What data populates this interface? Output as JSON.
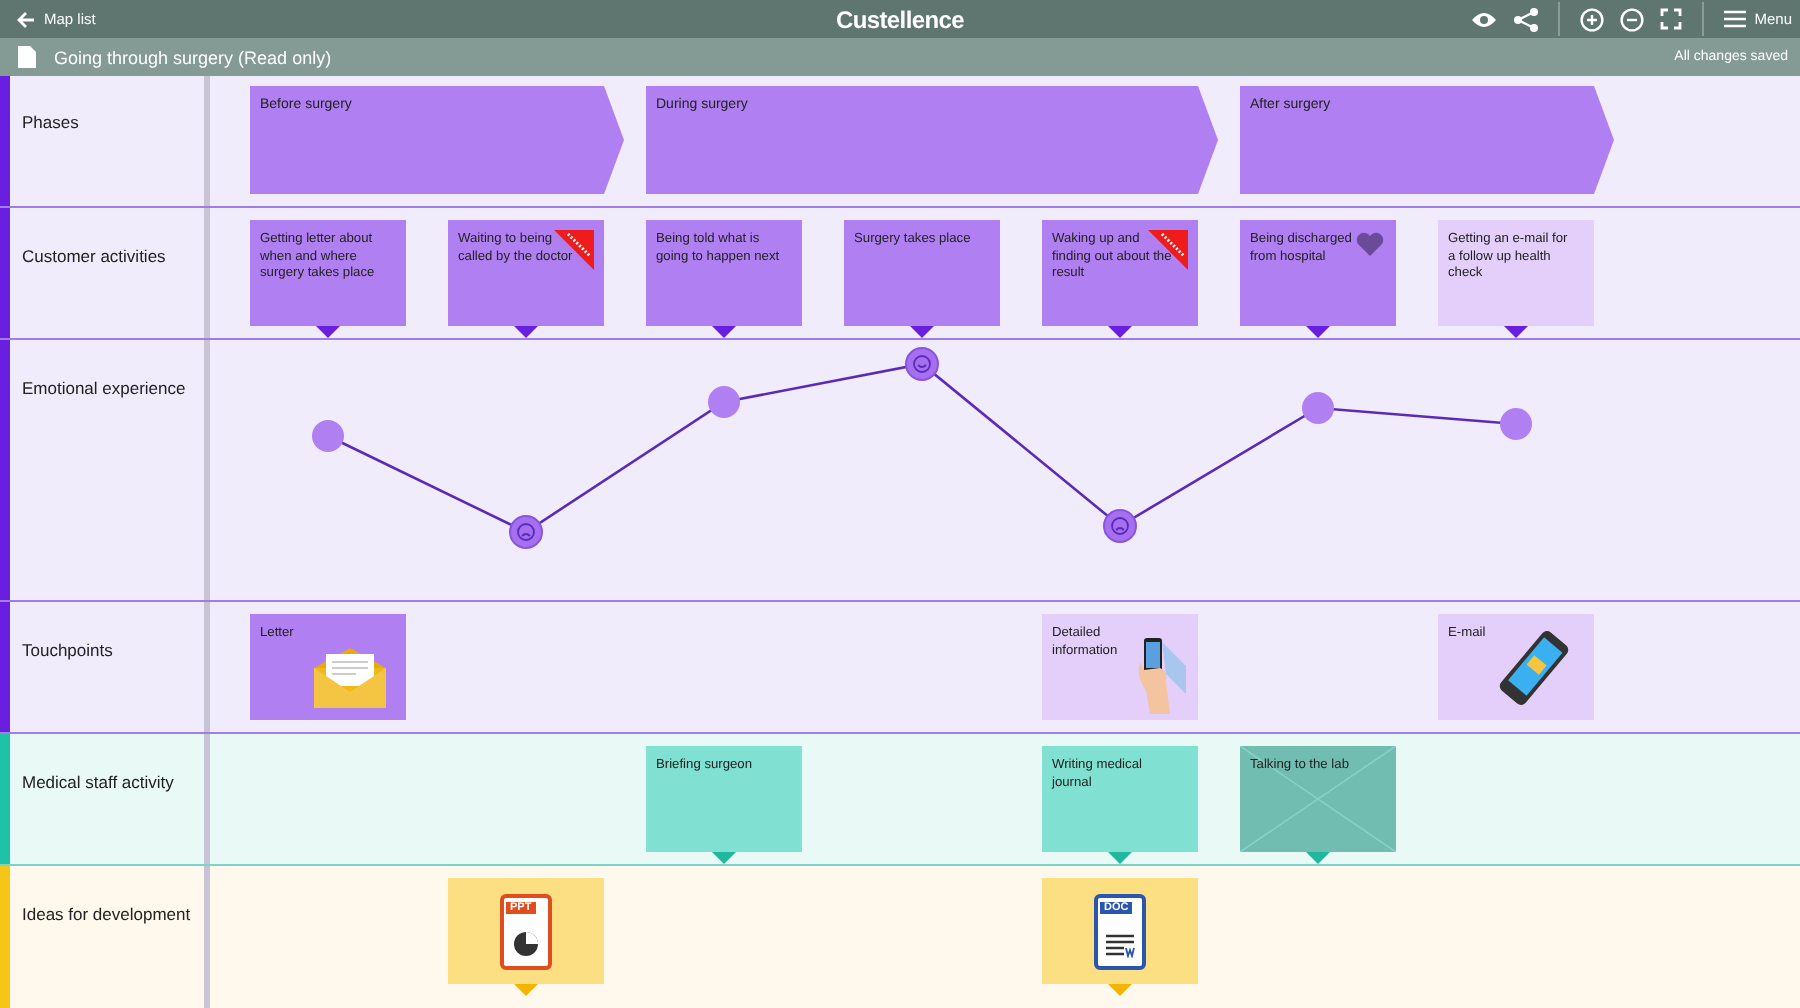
{
  "topbar": {
    "back_label": "Map list",
    "logo": "Custellence",
    "menu_label": "Menu"
  },
  "subbar": {
    "title": "Going through surgery (Read only)",
    "status": "All changes saved"
  },
  "lanes": [
    {
      "kind": "phases",
      "label": "Phases",
      "color": "#6a1ee0",
      "phases": [
        {
          "label": "Before surgery"
        },
        {
          "label": "During surgery"
        },
        {
          "label": "After surgery"
        }
      ]
    },
    {
      "kind": "cards",
      "label": "Customer activities",
      "color": "#6a1ee0",
      "cells": [
        {
          "kind": "activity",
          "text": "Getting letter about when and where surgery takes place",
          "priority": false,
          "liked": false
        },
        {
          "kind": "activity",
          "text": "Waiting to being called by the doctor",
          "priority": true,
          "liked": false
        },
        {
          "kind": "activity",
          "text": "Being told what is going to happen next",
          "priority": false,
          "liked": false
        },
        {
          "kind": "activity",
          "text": "Surgery takes place",
          "priority": false,
          "liked": false
        },
        {
          "kind": "activity",
          "text": "Waking up and finding out about the result",
          "priority": true,
          "liked": false
        },
        {
          "kind": "activity",
          "text": "Being discharged from hospital",
          "priority": false,
          "liked": true
        },
        {
          "kind": "draft",
          "text": "Getting an e-mail for a follow up health check",
          "priority": false,
          "liked": false
        }
      ]
    },
    {
      "kind": "emotion",
      "label": "Emotional experience",
      "color": "#6a1ee0",
      "points": [
        {
          "kind": "neutral"
        },
        {
          "kind": "sad"
        },
        {
          "kind": "neutral"
        },
        {
          "kind": "happy"
        },
        {
          "kind": "sad"
        },
        {
          "kind": "neutral"
        },
        {
          "kind": "neutral"
        }
      ]
    },
    {
      "kind": "touchpoints",
      "label": "Touchpoints",
      "color": "#6a1ee0",
      "cells": [
        {
          "kind": "letter",
          "text": "Letter"
        },
        null,
        null,
        null,
        {
          "kind": "info",
          "text": "Detailed information"
        },
        null,
        {
          "kind": "email",
          "text": "E-mail"
        }
      ]
    },
    {
      "kind": "cards",
      "label": "Medical staff activity",
      "color": "#1fc2a6",
      "cells": [
        null,
        null,
        {
          "kind": "activity",
          "text": "Briefing surgeon"
        },
        null,
        {
          "kind": "activity",
          "text": "Writing medical journal"
        },
        {
          "kind": "image",
          "text": "Talking to the lab"
        },
        null
      ]
    },
    {
      "kind": "files",
      "label": "Ideas for development",
      "color": "#f5c518",
      "cells": [
        null,
        {
          "kind": "ppt",
          "label": "PPT"
        },
        null,
        null,
        {
          "kind": "doc",
          "label": "DOC"
        },
        null,
        null
      ]
    }
  ]
}
